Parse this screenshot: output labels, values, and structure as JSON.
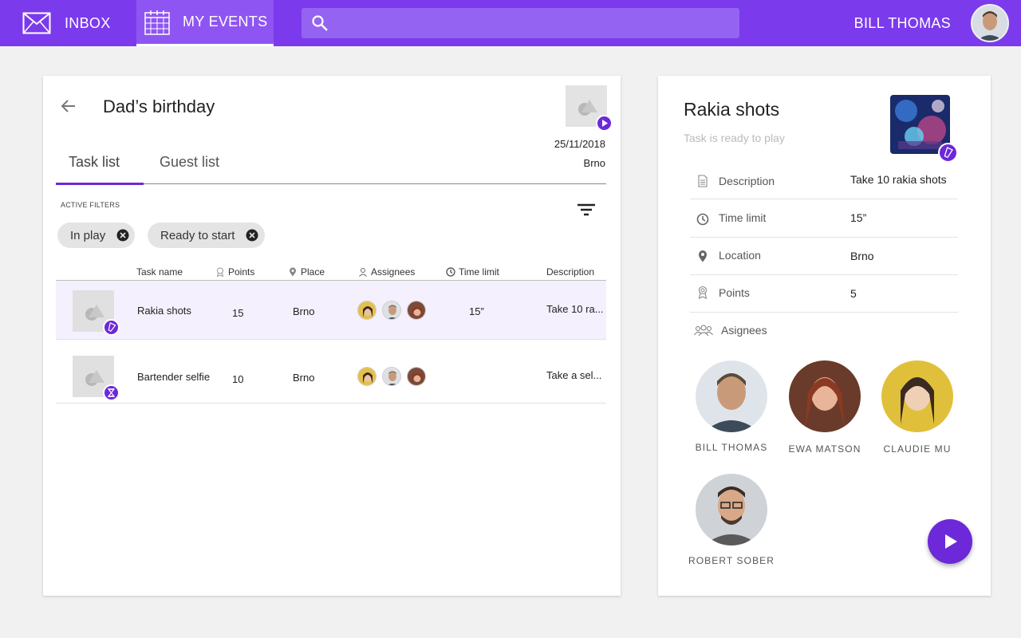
{
  "nav": {
    "inbox_label": "INBOX",
    "events_label": "MY EVENTS",
    "search_placeholder": "",
    "user_name": "BILL THOMAS"
  },
  "event": {
    "title": "Dad’s birthday",
    "date": "25/11/2018",
    "place": "Brno",
    "tabs": [
      "Task list",
      "Guest list"
    ]
  },
  "filters": {
    "label": "ACTIVE FILTERS",
    "chips": [
      "In play",
      "Ready to start"
    ]
  },
  "table": {
    "headers": [
      "Task name",
      "Points",
      "Place",
      "Assignees",
      "Time limit",
      "Description"
    ],
    "rows": [
      {
        "name": "Rakia shots",
        "points": "15",
        "place": "Brno",
        "time": "15”",
        "description": "Take 10 ra...",
        "badge_icon": "shot-glass-icon"
      },
      {
        "name": "Bartender selfie",
        "points": "10",
        "place": "Brno",
        "time": "",
        "description": "Take a sel...",
        "badge_icon": "hourglass-icon"
      }
    ]
  },
  "task": {
    "title": "Rakia shots",
    "status": "Task is ready to play",
    "details": [
      {
        "label": "Description",
        "value": "Take 10 rakia shots",
        "icon": "document-icon"
      },
      {
        "label": "Time limit",
        "value": "15”",
        "icon": "clock-icon"
      },
      {
        "label": "Location",
        "value": "Brno",
        "icon": "location-pin-icon"
      },
      {
        "label": "Points",
        "value": "5",
        "icon": "award-icon"
      }
    ],
    "assignees_label": "Asignees",
    "assignees": [
      "BILL THOMAS",
      "EWA MATSON",
      "CLAUDIE MU",
      "ROBERT SOBER"
    ]
  },
  "colors": {
    "accent": "#7c3aed",
    "accent_dark": "#6d28d9",
    "selected_row": "#f4f0fd"
  }
}
